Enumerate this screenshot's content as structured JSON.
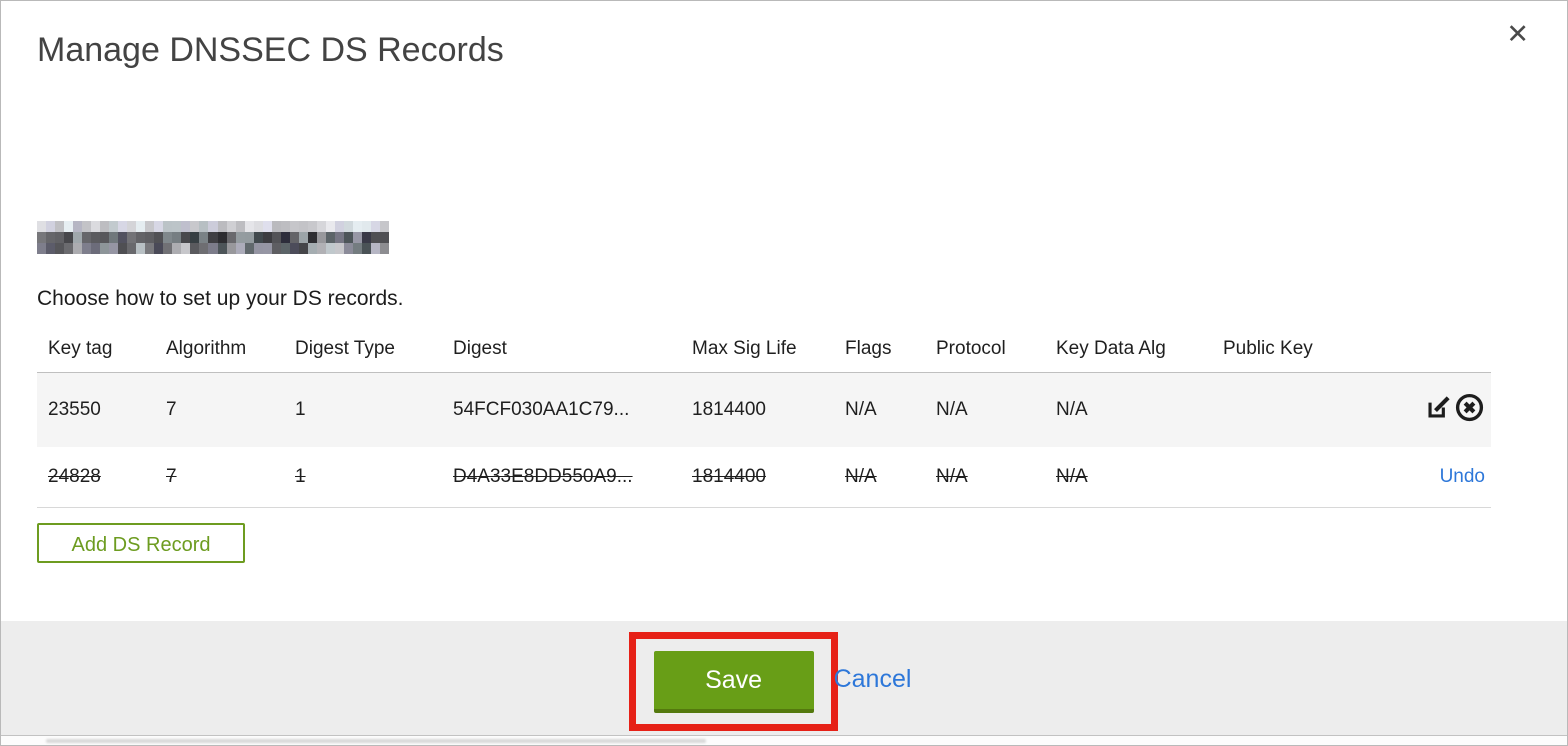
{
  "modal": {
    "title": "Manage DNSSEC DS Records",
    "close_label": "✕",
    "domain_redacted": true,
    "subtitle": "Choose how to set up your DS records.",
    "table": {
      "columns": [
        "Key tag",
        "Algorithm",
        "Digest Type",
        "Digest",
        "Max Sig Life",
        "Flags",
        "Protocol",
        "Key Data Alg",
        "Public Key"
      ],
      "rows": [
        {
          "key_tag": "23550",
          "algorithm": "7",
          "digest_type": "1",
          "digest": "54FCF030AA1C79...",
          "max_sig_life": "1814400",
          "flags": "N/A",
          "protocol": "N/A",
          "key_data_alg": "N/A",
          "public_key": "",
          "deleted": false,
          "actions": [
            "edit",
            "delete"
          ]
        },
        {
          "key_tag": "24828",
          "algorithm": "7",
          "digest_type": "1",
          "digest": "D4A33E8DD550A9...",
          "max_sig_life": "1814400",
          "flags": "N/A",
          "protocol": "N/A",
          "key_data_alg": "N/A",
          "public_key": "",
          "deleted": true,
          "undo_label": "Undo"
        }
      ]
    },
    "add_button_label": "Add DS Record",
    "footer": {
      "save_label": "Save",
      "cancel_label": "Cancel"
    },
    "colors": {
      "button_green": "#689e17",
      "button_green_dark": "#54790e",
      "outline_green": "#6d9c20",
      "link_blue": "#2d77d9",
      "annotation_red": "#e62117",
      "row_gray": "#f5f5f5",
      "footer_gray": "#ededed"
    }
  }
}
